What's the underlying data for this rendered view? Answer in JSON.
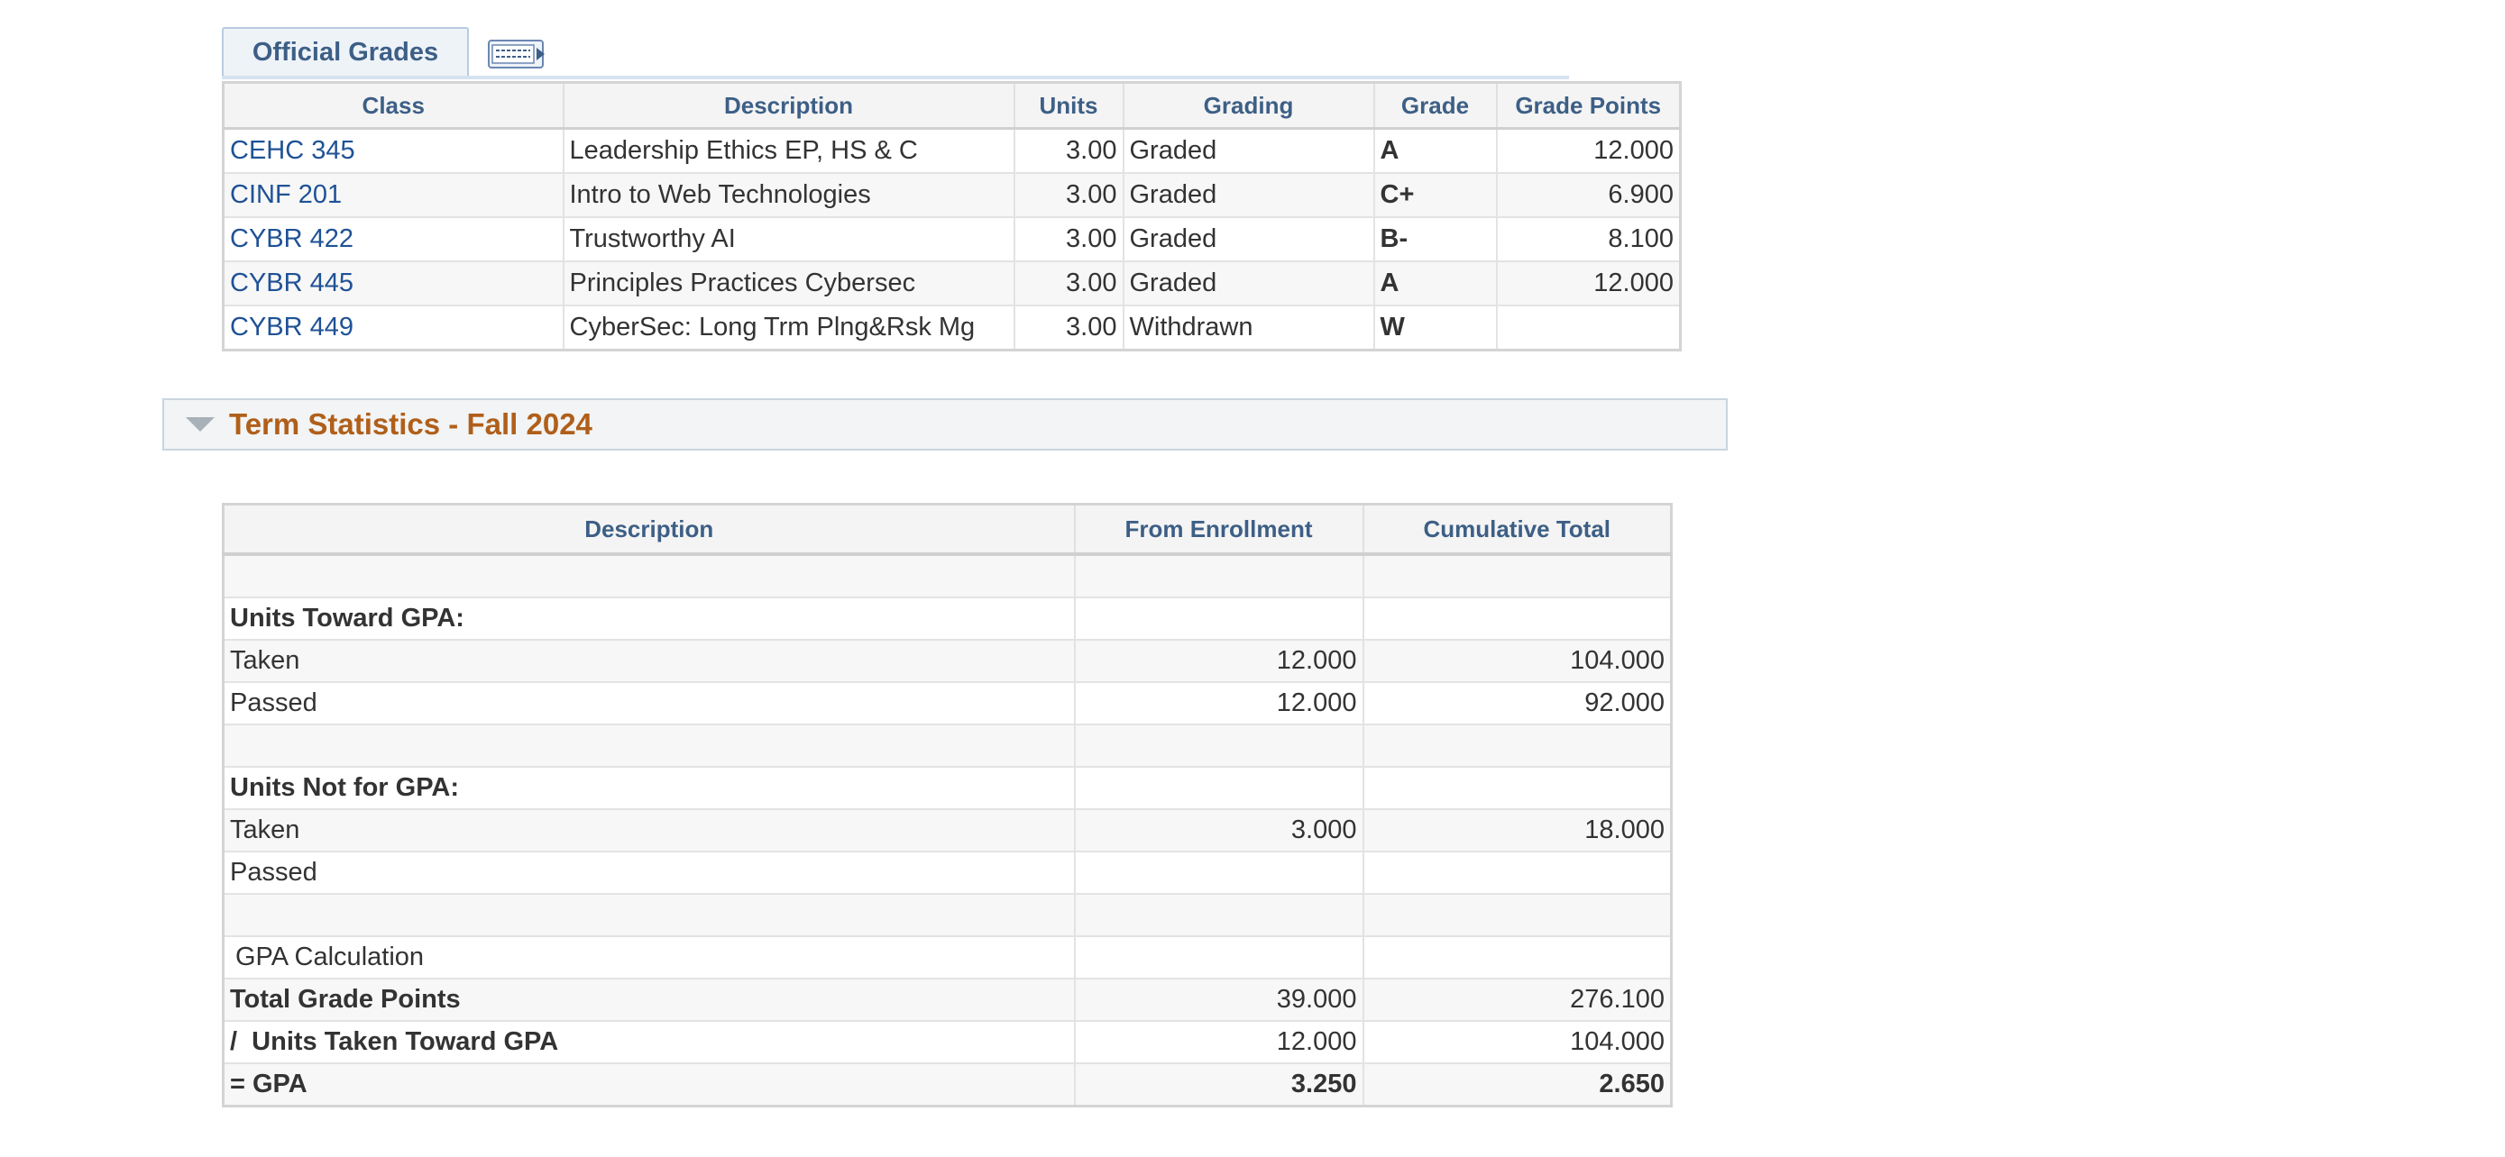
{
  "grades": {
    "tab_label": "Official Grades",
    "columns": [
      "Class",
      "Description",
      "Units",
      "Grading",
      "Grade",
      "Grade Points"
    ],
    "rows": [
      {
        "class": "CEHC 345",
        "description": "Leadership Ethics EP, HS & C",
        "units": "3.00",
        "grading": "Graded",
        "grade": "A",
        "points": "12.000"
      },
      {
        "class": "CINF 201",
        "description": "Intro to Web Technologies",
        "units": "3.00",
        "grading": "Graded",
        "grade": "C+",
        "points": "6.900"
      },
      {
        "class": "CYBR 422",
        "description": "Trustworthy AI",
        "units": "3.00",
        "grading": "Graded",
        "grade": "B-",
        "points": "8.100"
      },
      {
        "class": "CYBR 445",
        "description": "Principles Practices Cybersec",
        "units": "3.00",
        "grading": "Graded",
        "grade": "A",
        "points": "12.000"
      },
      {
        "class": "CYBR 449",
        "description": "CyberSec: Long Trm Plng&Rsk Mg",
        "units": "3.00",
        "grading": "Withdrawn",
        "grade": "W",
        "points": ""
      }
    ]
  },
  "term": {
    "title": "Term Statistics - Fall 2024",
    "columns": [
      "Description",
      "From Enrollment",
      "Cumulative Total"
    ],
    "units_toward_gpa": "Units Toward GPA:",
    "units_not_for_gpa": "Units Not for GPA:",
    "taken": "Taken",
    "passed": "Passed",
    "gpa_calc": "GPA Calculation",
    "total_grade_points": "Total Grade Points",
    "units_taken_toward_gpa": "/  Units Taken Toward GPA",
    "gpa": "= GPA",
    "values": {
      "gpa_taken": [
        "12.000",
        "104.000"
      ],
      "gpa_passed": [
        "12.000",
        "92.000"
      ],
      "nongpa_taken": [
        "3.000",
        "18.000"
      ],
      "nongpa_passed": [
        "",
        ""
      ],
      "total_points": [
        "39.000",
        "276.100"
      ],
      "units_taken": [
        "12.000",
        "104.000"
      ],
      "gpa": [
        "3.250",
        "2.650"
      ]
    }
  }
}
